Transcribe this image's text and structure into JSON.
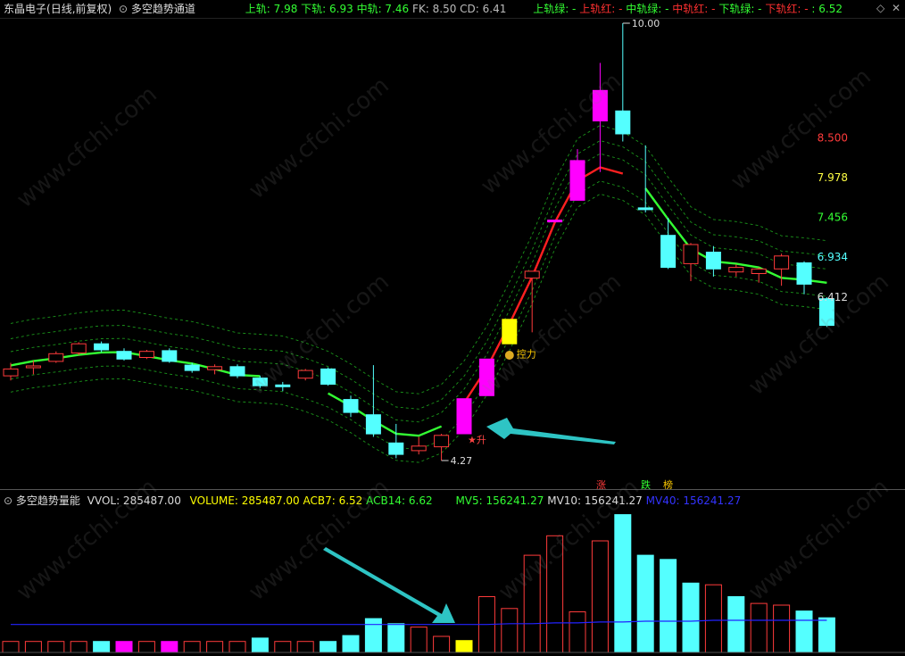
{
  "title_bar": {
    "stock_name": "东晶电子",
    "period": "(日线,前复权)",
    "indicator_name": "多空趋势通道",
    "vol_indicator_name": "多空趋势量能"
  },
  "indicator_values": {
    "upper_rail": "上轨: 7.98",
    "lower_rail": "下轨: 6.93",
    "mid_rail": "中轨: 7.46",
    "fk": "FK: 8.50",
    "cd": "CD: 6.41",
    "upper_green": "上轨绿: -",
    "upper_red": "上轨红: -",
    "mid_green": "中轨绿: -",
    "mid_red": "中轨红: -",
    "lower_green": "下轨绿: -",
    "lower_red": "下轨红: -",
    "last": ": 6.52"
  },
  "volume_values": {
    "vvol": "VVOL: 285487.00",
    "volume": "VOLUME: 285487.00",
    "acb7": "ACB7: 6.52",
    "acb14": "ACB14: 6.62",
    "mv5": "MV5: 156241.27",
    "mv10": "MV10: 156241.27",
    "mv40": "MV40: 156241.27"
  },
  "annotations": {
    "high_label": "10.00",
    "low_label": "4.27",
    "rise_label": "★升",
    "force_label": "控力",
    "up_tag": "涨",
    "down_tag": "跌",
    "limit_tag": "榜"
  },
  "axis_labels": [
    "8.500",
    "7.978",
    "7.456",
    "6.934",
    "6.412"
  ],
  "colors": {
    "up": "#ff3b3b",
    "down": "#54ffff",
    "limit_up": "#ff00ff",
    "highlight": "#ffff00",
    "channel_green": "#00cc00",
    "mid_line_up": "#ff2020",
    "mid_line_down": "#33ff33",
    "mv_line": "#2222ff"
  },
  "chart_data": [
    {
      "type": "candlestick",
      "title": "多空趋势通道",
      "y_tick_labels": [
        8.5,
        7.978,
        7.456,
        6.934,
        6.412
      ],
      "ylim": [
        4.0,
        10.2
      ],
      "high_marker": 10.0,
      "low_marker": 4.27,
      "candles": [
        {
          "o": 5.38,
          "c": 5.47,
          "h": 5.55,
          "l": 5.32,
          "kind": "up"
        },
        {
          "o": 5.5,
          "c": 5.51,
          "h": 5.58,
          "l": 5.4,
          "kind": "up"
        },
        {
          "o": 5.57,
          "c": 5.67,
          "h": 5.7,
          "l": 5.55,
          "kind": "up"
        },
        {
          "o": 5.68,
          "c": 5.8,
          "h": 5.82,
          "l": 5.65,
          "kind": "up"
        },
        {
          "o": 5.8,
          "c": 5.72,
          "h": 5.83,
          "l": 5.69,
          "kind": "down"
        },
        {
          "o": 5.7,
          "c": 5.6,
          "h": 5.74,
          "l": 5.58,
          "kind": "down"
        },
        {
          "o": 5.62,
          "c": 5.7,
          "h": 5.72,
          "l": 5.6,
          "kind": "up"
        },
        {
          "o": 5.71,
          "c": 5.57,
          "h": 5.74,
          "l": 5.55,
          "kind": "down"
        },
        {
          "o": 5.52,
          "c": 5.45,
          "h": 5.55,
          "l": 5.42,
          "kind": "down"
        },
        {
          "o": 5.46,
          "c": 5.5,
          "h": 5.53,
          "l": 5.4,
          "kind": "up"
        },
        {
          "o": 5.5,
          "c": 5.38,
          "h": 5.53,
          "l": 5.35,
          "kind": "down"
        },
        {
          "o": 5.35,
          "c": 5.25,
          "h": 5.38,
          "l": 5.22,
          "kind": "down"
        },
        {
          "o": 5.25,
          "c": 5.26,
          "h": 5.3,
          "l": 5.18,
          "kind": "down"
        },
        {
          "o": 5.35,
          "c": 5.45,
          "h": 5.47,
          "l": 5.32,
          "kind": "up"
        },
        {
          "o": 5.47,
          "c": 5.27,
          "h": 5.49,
          "l": 5.25,
          "kind": "down"
        },
        {
          "o": 5.07,
          "c": 4.9,
          "h": 5.12,
          "l": 4.84,
          "kind": "down"
        },
        {
          "o": 4.87,
          "c": 4.62,
          "h": 5.52,
          "l": 4.58,
          "kind": "down"
        },
        {
          "o": 4.5,
          "c": 4.35,
          "h": 4.75,
          "l": 4.3,
          "kind": "down"
        },
        {
          "o": 4.4,
          "c": 4.46,
          "h": 4.58,
          "l": 4.35,
          "kind": "up"
        },
        {
          "o": 4.45,
          "c": 4.6,
          "h": 4.62,
          "l": 4.27,
          "kind": "up"
        },
        {
          "o": 4.62,
          "c": 5.08,
          "h": 5.08,
          "l": 4.62,
          "kind": "limit_up"
        },
        {
          "o": 5.12,
          "c": 5.6,
          "h": 5.6,
          "l": 5.12,
          "kind": "limit_up"
        },
        {
          "o": 5.8,
          "c": 6.12,
          "h": 6.12,
          "l": 5.8,
          "kind": "limit"
        },
        {
          "o": 6.66,
          "c": 6.75,
          "h": 6.75,
          "l": 5.95,
          "kind": "up"
        },
        {
          "o": 7.42,
          "c": 7.42,
          "h": 7.42,
          "l": 7.42,
          "kind": "limit_up"
        },
        {
          "o": 7.68,
          "c": 8.2,
          "h": 8.35,
          "l": 7.68,
          "kind": "limit_up"
        },
        {
          "o": 8.72,
          "c": 9.12,
          "h": 9.48,
          "l": 8.05,
          "kind": "limit_up"
        },
        {
          "o": 8.85,
          "c": 8.55,
          "h": 10.0,
          "l": 8.45,
          "kind": "down"
        },
        {
          "o": 7.58,
          "c": 7.58,
          "h": 8.4,
          "l": 7.52,
          "kind": "down"
        },
        {
          "o": 7.22,
          "c": 6.8,
          "h": 7.45,
          "l": 6.78,
          "kind": "down"
        },
        {
          "o": 6.85,
          "c": 7.1,
          "h": 7.12,
          "l": 6.62,
          "kind": "up"
        },
        {
          "o": 7.0,
          "c": 6.78,
          "h": 7.08,
          "l": 6.68,
          "kind": "down"
        },
        {
          "o": 6.8,
          "c": 6.74,
          "h": 6.84,
          "l": 6.68,
          "kind": "up"
        },
        {
          "o": 6.72,
          "c": 6.78,
          "h": 6.8,
          "l": 6.6,
          "kind": "up"
        },
        {
          "o": 6.78,
          "c": 6.95,
          "h": 6.98,
          "l": 6.56,
          "kind": "up"
        },
        {
          "o": 6.86,
          "c": 6.58,
          "h": 6.88,
          "l": 6.45,
          "kind": "down"
        },
        {
          "o": 6.39,
          "c": 6.04,
          "h": 6.41,
          "l": 6.02,
          "kind": "down"
        }
      ]
    },
    {
      "type": "bar",
      "title": "多空趋势量能",
      "values": [
        13,
        13,
        13,
        13,
        13,
        13,
        13,
        13,
        13,
        13,
        13,
        17,
        13,
        13,
        13,
        20,
        40,
        34,
        30,
        19,
        14,
        66,
        52,
        115,
        138,
        48,
        132,
        163,
        115,
        110,
        82,
        80,
        66,
        58,
        56,
        49,
        41
      ],
      "kinds": [
        "up",
        "up",
        "up",
        "up",
        "down",
        "limit_up",
        "up",
        "limit_up",
        "up",
        "up",
        "up",
        "down",
        "up",
        "up",
        "down",
        "down",
        "down",
        "down",
        "up",
        "up",
        "limit",
        "up",
        "up",
        "up",
        "up",
        "up",
        "up",
        "down",
        "down",
        "down",
        "down",
        "up",
        "down",
        "up",
        "up",
        "down",
        "down"
      ],
      "mv40_line": [
        33,
        33,
        33,
        33,
        33,
        33,
        33,
        33,
        33,
        33,
        33,
        33,
        33,
        33,
        33,
        33,
        33,
        33,
        33,
        33,
        33,
        33,
        34,
        34,
        35,
        35,
        36,
        36,
        37,
        37,
        37,
        38,
        38,
        38,
        38,
        38,
        38
      ],
      "ylim": [
        0,
        170
      ]
    }
  ]
}
